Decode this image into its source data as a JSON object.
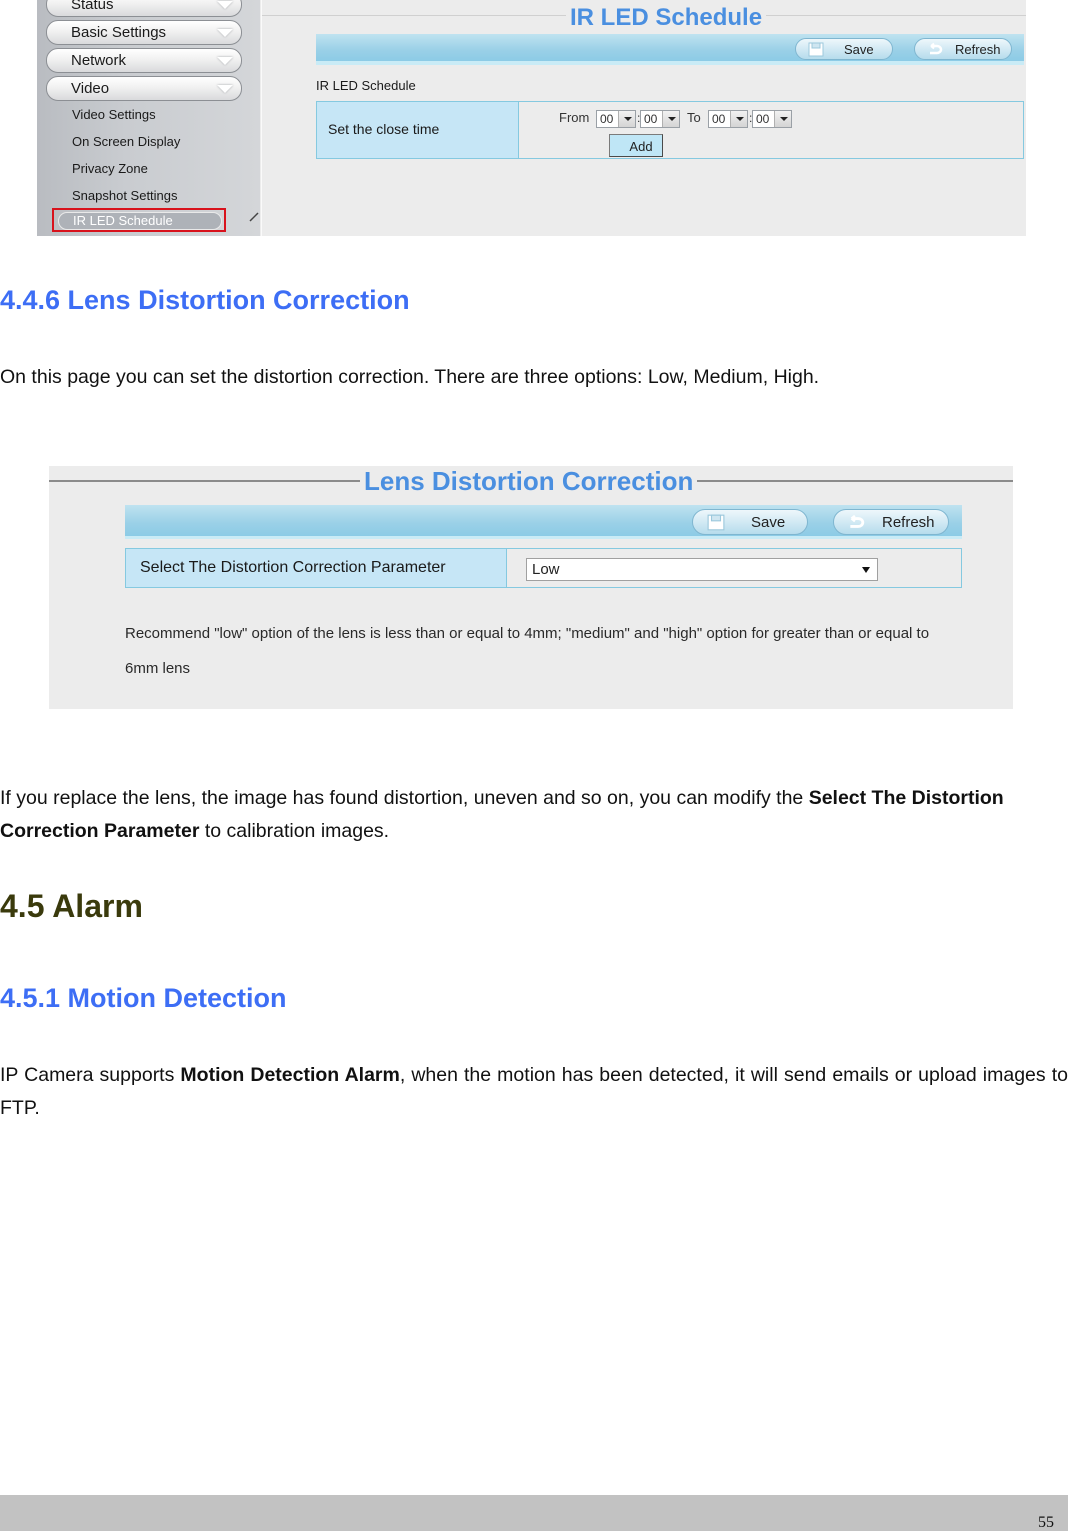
{
  "ir_led_screenshot": {
    "sidebar": {
      "menus": [
        {
          "label": "Status"
        },
        {
          "label": "Basic Settings"
        },
        {
          "label": "Network"
        },
        {
          "label": "Video"
        }
      ],
      "video_submenu": [
        {
          "label": "Video Settings"
        },
        {
          "label": "On Screen Display"
        },
        {
          "label": "Privacy Zone"
        },
        {
          "label": "Snapshot Settings"
        },
        {
          "label": "IR LED Schedule",
          "active": true
        }
      ]
    },
    "title": "IR LED Schedule",
    "toolbar": {
      "save_label": "Save",
      "refresh_label": "Refresh"
    },
    "section_label": "IR LED Schedule",
    "row_label": "Set the close time",
    "from_label": "From",
    "to_label": "To",
    "colon": ":",
    "from_hour": "00",
    "from_minute": "00",
    "to_hour": "00",
    "to_minute": "00",
    "add_label": "Add",
    "highlight_color": "#d8121c"
  },
  "section_446": {
    "heading": "4.4.6 Lens Distortion Correction",
    "intro": "On this page you can set the distortion correction. There are three options: Low, Medium, High."
  },
  "lens_screenshot": {
    "title": "Lens Distortion Correction",
    "toolbar": {
      "save_label": "Save",
      "refresh_label": "Refresh"
    },
    "param_label": "Select The Distortion Correction Parameter",
    "param_value": "Low",
    "recommend_line1": "Recommend \"low\" option of the lens is less than or equal to 4mm; \"medium\" and \"high\" option for greater than or equal to",
    "recommend_line2": "6mm lens"
  },
  "para_replace": {
    "pre": "If you replace the lens, the image has found distortion, uneven and so on, you can modify the ",
    "bold": "Select The Distortion Correction Parameter",
    "post": " to calibration images."
  },
  "section_45": {
    "heading": "4.5 Alarm"
  },
  "section_451": {
    "heading": "4.5.1 Motion Detection",
    "pre": "IP Camera supports ",
    "bold": "Motion Detection Alarm",
    "post": ", when the motion has been detected, it will send emails or upload images to FTP."
  },
  "footer": {
    "page_number": "55"
  },
  "colors": {
    "heading_blue": "#3d6ef5",
    "heading_dark": "#3a3a0c",
    "ui_title_blue": "#4a8fe0",
    "toolbar_blue": "#9ad0e7",
    "row_label_bg": "#c6e6f6"
  }
}
